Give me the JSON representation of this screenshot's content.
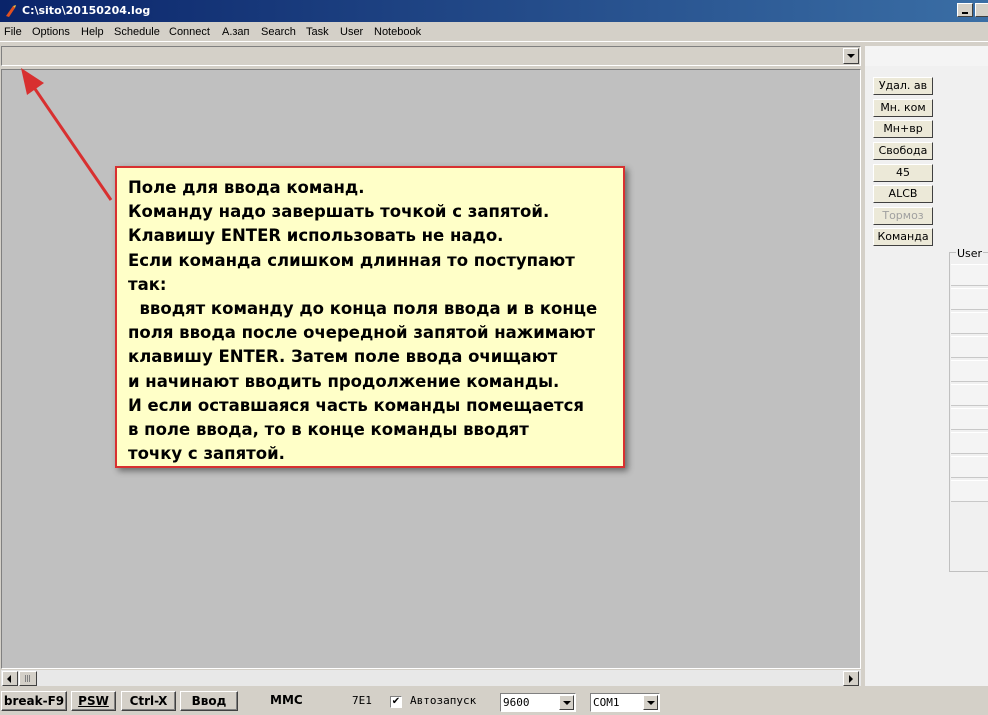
{
  "window": {
    "title": "C:\\sito\\20150204.log",
    "accent": "#0a246a"
  },
  "menu": [
    {
      "label": "File"
    },
    {
      "label": "Options"
    },
    {
      "label": "Help"
    },
    {
      "label": "Schedule"
    },
    {
      "label": "Connect"
    },
    {
      "label": "A.зап"
    },
    {
      "label": "Search"
    },
    {
      "label": "Task"
    },
    {
      "label": "User"
    },
    {
      "label": "Notebook"
    }
  ],
  "command_input": {
    "value": "",
    "placeholder": ""
  },
  "side_buttons": [
    {
      "label": "Удал. ав",
      "enabled": true
    },
    {
      "label": "Мн. ком",
      "enabled": true
    },
    {
      "label": "Мн+вр",
      "enabled": true
    },
    {
      "label": "Свобода",
      "enabled": true
    },
    {
      "label": "45",
      "enabled": true
    },
    {
      "label": "ALCB",
      "enabled": true
    },
    {
      "label": "Тормоз",
      "enabled": false
    },
    {
      "label": "Команда",
      "enabled": true
    }
  ],
  "user_group": {
    "label": "User"
  },
  "callout": {
    "border_color": "#d83030",
    "background": "#ffffc8",
    "lines": [
      "Поле для ввода команд.",
      "Команду надо завершать точкой с запятой.",
      "Клавишу ENTER использовать не надо.",
      "Если команда слишком длинная то поступают",
      "так:",
      "  вводят команду до конца поля ввода и в конце",
      "поля ввода после очередной запятой нажимают",
      "клавишу ENTER. Затем поле ввода очищают",
      "и начинают вводить продолжение команды.",
      "И если оставшаяся часть команды помещается",
      "в поле ввода, то в конце команды вводят",
      "точку с запятой."
    ]
  },
  "statusbar": {
    "break_label": "break-F9",
    "psw_label": "PSW",
    "ctrlx_label": "Ctrl-X",
    "vvod_label": "Ввод",
    "mode_text": "MMC",
    "parity_text": "7E1",
    "autostart_checked": true,
    "autostart_label": "Автозапуск",
    "baud_value": "9600",
    "port_value": "COM1"
  }
}
